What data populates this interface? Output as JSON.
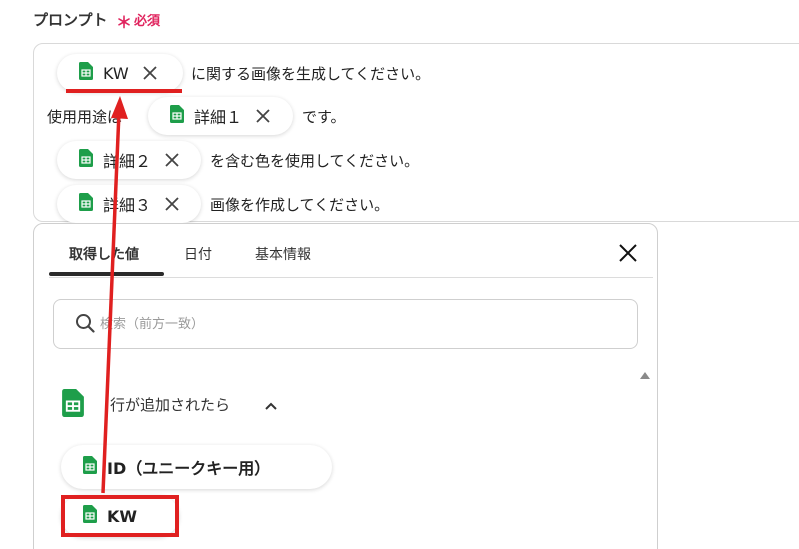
{
  "field": {
    "label": "プロンプト",
    "required_star": "＊",
    "required_text": "必須"
  },
  "prompt": {
    "line1": {
      "chip": "KW",
      "text": "に関する画像を生成してください。"
    },
    "line2": {
      "prefix": "使用用途は",
      "chip": "詳細１",
      "text": "です。"
    },
    "line3": {
      "chip": "詳細２",
      "text": "を含む色を使用してください。"
    },
    "line4": {
      "chip": "詳細３",
      "text": "画像を作成してください。"
    }
  },
  "panel": {
    "tabs": [
      {
        "label": "取得した値",
        "active": true
      },
      {
        "label": "日付",
        "active": false
      },
      {
        "label": "基本情報",
        "active": false
      }
    ],
    "search_placeholder": "検索（前方一致）",
    "group_title": "行が追加されたら",
    "items": [
      {
        "label": "ID（ユニークキー用）"
      },
      {
        "label": "KW"
      }
    ]
  },
  "colors": {
    "sheets_green": "#1e9e4a",
    "required_red": "#e0245e",
    "annotation_red": "#e02020"
  },
  "icons": {
    "chip_icon": "google-sheets-icon",
    "remove": "close-icon",
    "search": "search-icon",
    "collapse": "chevron-up-icon"
  }
}
